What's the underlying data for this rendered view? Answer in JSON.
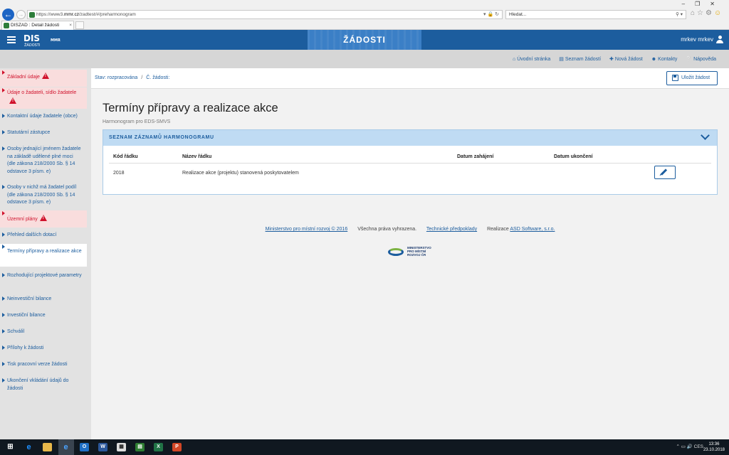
{
  "browser": {
    "url_prefix": "https://www3.",
    "url_host": "mmr.cz",
    "url_path": "/zadtest/#/preharmonogram",
    "search_placeholder": "Hledat...",
    "tab_title": "DISZAD : Detail žádosti"
  },
  "header": {
    "logo": "DIS",
    "logo_sub": "ŽÁDOSTI",
    "logo_mmr": "MMR",
    "title": "ŽÁDOSTI",
    "user": "mrkev mrkev"
  },
  "topnav": {
    "items": [
      {
        "label": "Úvodní stránka",
        "icon": "home-icon"
      },
      {
        "label": "Seznam žádostí",
        "icon": "list-icon"
      },
      {
        "label": "Nová žádost",
        "icon": "plus-icon"
      },
      {
        "label": "Kontakty",
        "icon": "contacts-icon"
      },
      {
        "label": "Nápověda",
        "icon": "help-icon"
      }
    ]
  },
  "sidebar": {
    "items": [
      {
        "label": "Základní údaje",
        "state": "error"
      },
      {
        "label": "Údaje o žadateli, sídlo žadatele",
        "state": "error"
      },
      {
        "label": "Kontaktní údaje žadatele (obce)",
        "state": "normal"
      },
      {
        "label": "Statutární zástupce",
        "state": "normal"
      },
      {
        "label": "Osoby jednající jménem žadatele na základě udělené plné moci (dle zákona 218/2000 Sb. § 14 odstavce 3 písm. e)",
        "state": "normal"
      },
      {
        "label": "Osoby v nichž má žadatel podíl (dle zákona 218/2000 Sb. § 14 odstavce 3 písm. e)",
        "state": "normal"
      },
      {
        "label": "Územní plány",
        "state": "error"
      },
      {
        "label": "Přehled dalších dotací",
        "state": "normal"
      },
      {
        "label": "Termíny přípravy a realizace akce",
        "state": "active"
      },
      {
        "label": "Rozhodující projektové parametry",
        "state": "normal"
      },
      {
        "label": "Neinvestiční bilance",
        "state": "normal"
      },
      {
        "label": "Investiční bilance",
        "state": "normal"
      },
      {
        "label": "Schválil",
        "state": "normal"
      },
      {
        "label": "Přílohy k žádosti",
        "state": "normal"
      },
      {
        "label": "Tisk pracovní verze žádosti",
        "state": "normal"
      },
      {
        "label": "Ukončení vkládání údajů do žádosti",
        "state": "normal"
      }
    ]
  },
  "breadcrumb": {
    "status": "Stav: rozpracována",
    "separator": "/",
    "number": "Č. žádosti:"
  },
  "save_label": "Uložit žádost",
  "main": {
    "title": "Termíny přípravy a realizace akce",
    "subtitle": "Harmonogram pro EDS-SMVS",
    "panel_title": "SEZNAM ZÁZNAMŮ HARMONOGRAMU",
    "columns": [
      "Kód řádku",
      "Název řádku",
      "Datum zahájení",
      "Datum ukončení"
    ],
    "rows": [
      {
        "code": "2018",
        "name": "Realizace akce (projektu) stanovená poskytovatelem",
        "start": "",
        "end": ""
      }
    ]
  },
  "footer": {
    "copyright": "Ministerstvo pro místní rozvoj © 2016",
    "rights": "Všechna práva vyhrazena.",
    "tech": "Technické předpoklady",
    "realization": "Realizace",
    "vendor": "ASD Software, s.r.o.",
    "logo_text": "MINISTERSTVO\nPRO MÍSTNÍ\nROZVOJ ČR"
  },
  "taskbar": {
    "lang": "CES",
    "time": "13:36",
    "date": "23.10.2018"
  },
  "colors": {
    "brand": "#1c5d9e",
    "error": "#d0112b",
    "panel_header": "#bfdbf3"
  }
}
